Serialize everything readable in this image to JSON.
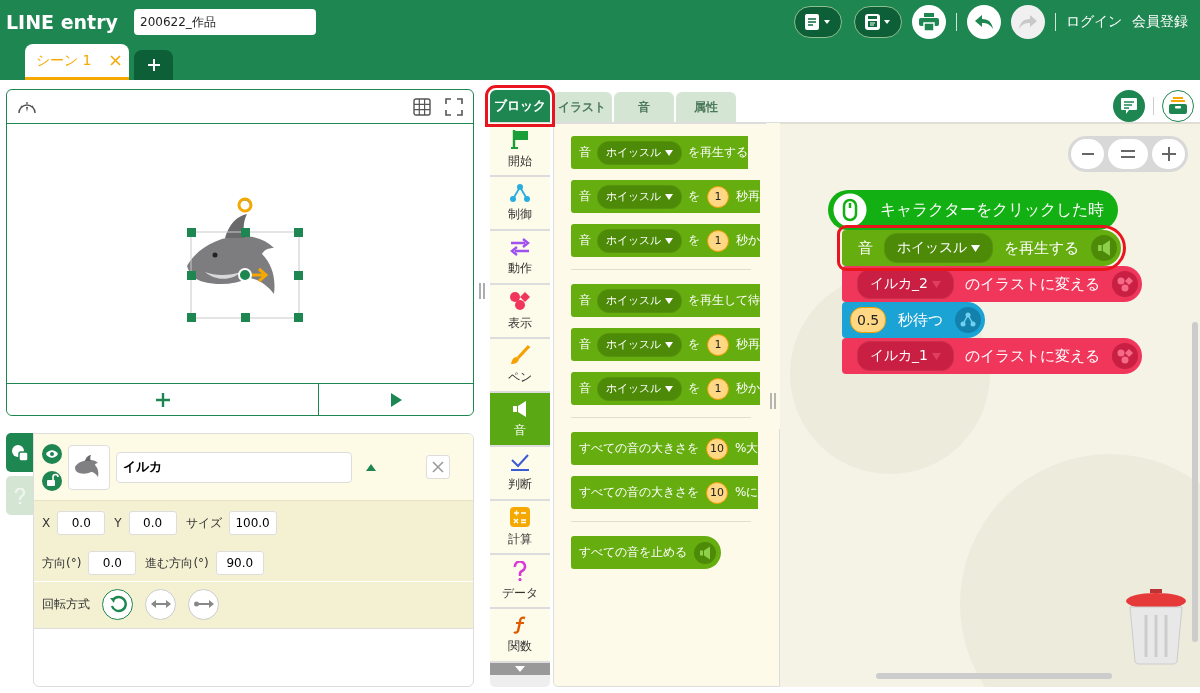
{
  "header": {
    "logo": "LINE entry",
    "project_name": "200622_作品",
    "login": "ログイン",
    "signup": "会員登録",
    "redo_disabled": true
  },
  "scene_tabs": [
    {
      "label": "シーン 1",
      "selected": true
    }
  ],
  "object": {
    "name": "イルカ",
    "visible": true,
    "fields": [
      {
        "label": "X",
        "value": "0.0"
      },
      {
        "label": "Y",
        "value": "0.0"
      },
      {
        "label": "サイズ",
        "value": "100.0"
      }
    ],
    "fields2": [
      {
        "label": "方向(°)",
        "value": "0.0"
      },
      {
        "label": "進む方向(°)",
        "value": "90.0"
      }
    ],
    "rotation_label": "回転方式",
    "rotation_modes": [
      {
        "kind": "free",
        "selected": true
      },
      {
        "kind": "flip",
        "selected": false
      },
      {
        "kind": "none",
        "selected": false
      }
    ]
  },
  "side_tabs": [
    {
      "kind": "objects",
      "selected": true
    },
    {
      "kind": "help",
      "selected": false
    }
  ],
  "palette_tabs": [
    {
      "label": "ブロック",
      "selected": true,
      "highlighted": true
    },
    {
      "label": "イラスト",
      "selected": false,
      "highlighted": false
    },
    {
      "label": "音",
      "selected": false,
      "highlighted": false
    },
    {
      "label": "属性",
      "selected": false,
      "highlighted": false
    }
  ],
  "categories": [
    {
      "kind": "start",
      "label": "開始",
      "selected": false
    },
    {
      "kind": "control",
      "label": "制御",
      "selected": false
    },
    {
      "kind": "motion",
      "label": "動作",
      "selected": false
    },
    {
      "kind": "looks",
      "label": "表示",
      "selected": false
    },
    {
      "kind": "pen",
      "label": "ペン",
      "selected": false
    },
    {
      "kind": "sound",
      "label": "音",
      "selected": true
    },
    {
      "kind": "judge",
      "label": "判断",
      "selected": false
    },
    {
      "kind": "calc",
      "label": "計算",
      "selected": false
    },
    {
      "kind": "data",
      "label": "データ",
      "selected": false
    },
    {
      "kind": "function",
      "label": "関数",
      "selected": false
    }
  ],
  "palette_groups": [
    {
      "blocks": [
        {
          "icon": false,
          "parts": [
            {
              "kind": "text",
              "text": "音"
            },
            {
              "kind": "dropdown",
              "text": "ホイッスル"
            },
            {
              "kind": "text",
              "text": "を再生する"
            }
          ]
        },
        {
          "icon": false,
          "parts": [
            {
              "kind": "text",
              "text": "音"
            },
            {
              "kind": "dropdown",
              "text": "ホイッスル"
            },
            {
              "kind": "text",
              "text": "を"
            },
            {
              "kind": "number",
              "text": "1"
            },
            {
              "kind": "text",
              "text": "秒再"
            }
          ]
        },
        {
          "icon": false,
          "parts": [
            {
              "kind": "text",
              "text": "音"
            },
            {
              "kind": "dropdown",
              "text": "ホイッスル"
            },
            {
              "kind": "text",
              "text": "を"
            },
            {
              "kind": "number",
              "text": "1"
            },
            {
              "kind": "text",
              "text": "秒か"
            }
          ]
        }
      ]
    },
    {
      "blocks": [
        {
          "icon": false,
          "parts": [
            {
              "kind": "text",
              "text": "音"
            },
            {
              "kind": "dropdown",
              "text": "ホイッスル"
            },
            {
              "kind": "text",
              "text": "を再生して待"
            }
          ]
        },
        {
          "icon": false,
          "parts": [
            {
              "kind": "text",
              "text": "音"
            },
            {
              "kind": "dropdown",
              "text": "ホイッスル"
            },
            {
              "kind": "text",
              "text": "を"
            },
            {
              "kind": "number",
              "text": "1"
            },
            {
              "kind": "text",
              "text": "秒再"
            }
          ]
        },
        {
          "icon": false,
          "parts": [
            {
              "kind": "text",
              "text": "音"
            },
            {
              "kind": "dropdown",
              "text": "ホイッスル"
            },
            {
              "kind": "text",
              "text": "を"
            },
            {
              "kind": "number",
              "text": "1"
            },
            {
              "kind": "text",
              "text": "秒か"
            }
          ]
        }
      ]
    },
    {
      "blocks": [
        {
          "icon": false,
          "parts": [
            {
              "kind": "text",
              "text": "すべての音の大きさを"
            },
            {
              "kind": "number",
              "text": "10"
            },
            {
              "kind": "text",
              "text": "%大"
            }
          ]
        },
        {
          "icon": false,
          "parts": [
            {
              "kind": "text",
              "text": "すべての音の大きさを"
            },
            {
              "kind": "number",
              "text": "10"
            },
            {
              "kind": "text",
              "text": "%に"
            }
          ]
        }
      ]
    },
    {
      "blocks": [
        {
          "icon": true,
          "parts": [
            {
              "kind": "text",
              "text": "すべての音を止める"
            }
          ]
        }
      ]
    }
  ],
  "script": [
    {
      "kind": "event",
      "highlighted": false,
      "parts": [
        {
          "kind": "text",
          "text": "キャラクターをクリックした時"
        }
      ]
    },
    {
      "kind": "sound",
      "highlighted": true,
      "parts": [
        {
          "kind": "text",
          "text": "音"
        },
        {
          "kind": "dropdown",
          "text": "ホイッスル"
        },
        {
          "kind": "text",
          "text": "を再生する"
        }
      ]
    },
    {
      "kind": "looks",
      "highlighted": false,
      "parts": [
        {
          "kind": "dropdown",
          "text": "イルカ_2"
        },
        {
          "kind": "text",
          "text": "のイラストに変える"
        }
      ]
    },
    {
      "kind": "flow",
      "highlighted": false,
      "parts": [
        {
          "kind": "number",
          "text": "0.5"
        },
        {
          "kind": "text",
          "text": "秒待つ"
        }
      ]
    },
    {
      "kind": "looks",
      "highlighted": false,
      "parts": [
        {
          "kind": "dropdown",
          "text": "イルカ_1"
        },
        {
          "kind": "text",
          "text": "のイラストに変える"
        }
      ]
    }
  ]
}
